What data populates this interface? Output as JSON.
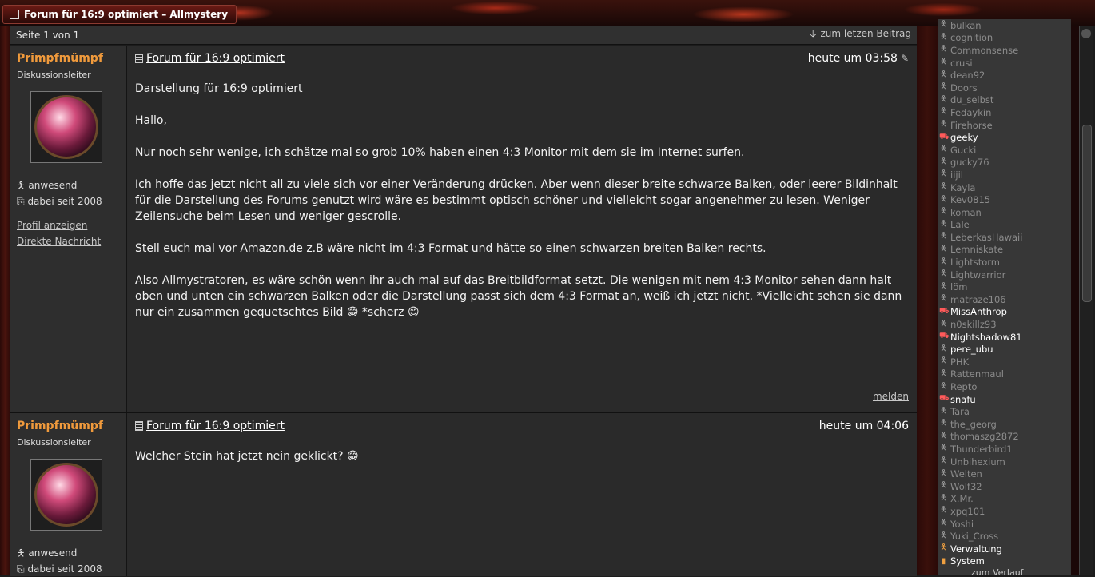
{
  "window": {
    "tab_title": "Forum für 16:9 optimiert – Allmystery"
  },
  "pager": {
    "page_info": "Seite 1 von 1",
    "latest_link": "zum letzen Beitrag"
  },
  "posts": [
    {
      "username": "Primpfmümpf",
      "role": "Diskussionsleiter",
      "status": "anwesend",
      "since": "dabei seit 2008",
      "profile_link": "Profil anzeigen",
      "message_link": "Direkte Nachricht",
      "title": "Forum für 16:9 optimiert",
      "time": "heute um 03:58",
      "paragraphs": [
        "Darstellung für 16:9 optimiert",
        "Hallo,",
        "Nur noch sehr wenige, ich schätze mal so grob 10% haben einen 4:3 Monitor mit dem sie im Internet surfen.",
        "Ich hoffe das jetzt nicht all zu viele sich vor einer Veränderung drücken. Aber wenn dieser breite schwarze Balken, oder leerer Bildinhalt für die Darstellung des Forums genutzt wird wäre es bestimmt optisch schöner und vielleicht sogar angenehmer zu lesen. Weniger Zeilensuche beim Lesen und weniger gescrolle.",
        "Stell euch mal vor Amazon.de z.B wäre nicht im 4:3 Format und hätte so einen schwarzen breiten Balken rechts.",
        "Also Allmystratoren, es wäre schön wenn ihr auch mal auf das Breitbildformat setzt. Die wenigen mit nem 4:3 Monitor sehen dann halt oben und unten ein schwarzen Balken oder die Darstellung passt sich dem 4:3 Format an, weiß ich jetzt nicht. *Vielleicht sehen sie dann nur ein zusammen gequetschtes Bild 😁 *scherz 😊"
      ],
      "report_link": "melden"
    },
    {
      "username": "Primpfmümpf",
      "role": "Diskussionsleiter",
      "status": "anwesend",
      "since": "dabei seit 2008",
      "title": "Forum für 16:9 optimiert",
      "time": "heute um 04:06",
      "paragraphs": [
        "Welcher Stein hat jetzt nein geklickt? 😁"
      ]
    }
  ],
  "members": [
    {
      "name": "bulkan",
      "online": false
    },
    {
      "name": "cognition",
      "online": false
    },
    {
      "name": "Commonsense",
      "online": false
    },
    {
      "name": "crusi",
      "online": false
    },
    {
      "name": "dean92",
      "online": false
    },
    {
      "name": "Doors",
      "online": false
    },
    {
      "name": "du_selbst",
      "online": false
    },
    {
      "name": "Fedaykin",
      "online": false
    },
    {
      "name": "Firehorse",
      "online": false
    },
    {
      "name": "geeky",
      "online": true
    },
    {
      "name": "Gucki",
      "online": false
    },
    {
      "name": "gucky76",
      "online": false
    },
    {
      "name": "iijil",
      "online": false
    },
    {
      "name": "Kayla",
      "online": false
    },
    {
      "name": "Kev0815",
      "online": false
    },
    {
      "name": "koman",
      "online": false
    },
    {
      "name": "Lale",
      "online": false
    },
    {
      "name": "LeberkasHawaii",
      "online": false
    },
    {
      "name": "Lemniskate",
      "online": false
    },
    {
      "name": "Lightstorm",
      "online": false
    },
    {
      "name": "Lightwarrior",
      "online": false
    },
    {
      "name": "löm",
      "online": false
    },
    {
      "name": "matraze106",
      "online": false
    },
    {
      "name": "MissAnthrop",
      "online": true
    },
    {
      "name": "n0skillz93",
      "online": false
    },
    {
      "name": "Nightshadow81",
      "online": true
    },
    {
      "name": "pere_ubu",
      "online": true,
      "white_icon": true
    },
    {
      "name": "PHK",
      "online": false
    },
    {
      "name": "Rattenmaul",
      "online": false
    },
    {
      "name": "Repto",
      "online": false
    },
    {
      "name": "snafu",
      "online": true
    },
    {
      "name": "Tara",
      "online": false
    },
    {
      "name": "the_georg",
      "online": false
    },
    {
      "name": "thomaszg2872",
      "online": false
    },
    {
      "name": "Thunderbird1",
      "online": false
    },
    {
      "name": "Unbihexium",
      "online": false
    },
    {
      "name": "Welten",
      "online": false
    },
    {
      "name": "Wolf32",
      "online": false
    },
    {
      "name": "X.Mr.",
      "online": false
    },
    {
      "name": "xpq101",
      "online": false
    },
    {
      "name": "Yoshi",
      "online": false
    },
    {
      "name": "Yuki_Cross",
      "online": false
    },
    {
      "name": "Verwaltung",
      "online": true,
      "admin": true
    },
    {
      "name": "System",
      "online": true,
      "system": true
    }
  ],
  "members_more": "zum Verlauf",
  "colors": {
    "username": "#f09a3c",
    "online_icon": "#ff5a5a",
    "admin_icon": "#f0a040"
  }
}
